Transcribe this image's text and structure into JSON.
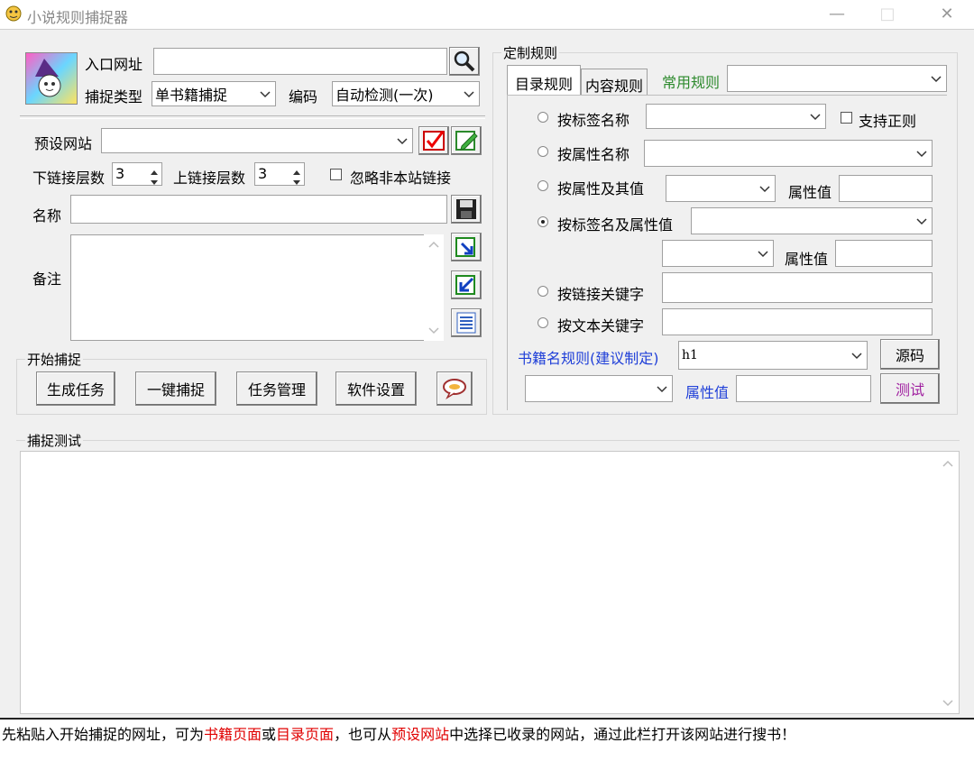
{
  "window": {
    "title": "小说规则捕捉器",
    "minimize": "—",
    "maximize": "□",
    "close": "✕"
  },
  "top": {
    "entry_url_label": "入口网址",
    "entry_url_value": "",
    "capture_type_label": "捕捉类型",
    "capture_type_value": "单书籍捕捉",
    "encoding_label": "编码",
    "encoding_value": "自动检测(一次)"
  },
  "preset": {
    "preset_site_label": "预设网站",
    "preset_site_value": "",
    "down_depth_label": "下链接层数",
    "down_depth_value": "3",
    "up_depth_label": "上链接层数",
    "up_depth_value": "3",
    "ignore_offsite_label": "忽略非本站链接",
    "ignore_offsite_checked": false,
    "name_label": "名称",
    "name_value": "",
    "note_label": "备注",
    "note_value": ""
  },
  "start_group": {
    "label": "开始捕捉",
    "buttons": [
      "生成任务",
      "一键捕捉",
      "任务管理",
      "软件设置"
    ]
  },
  "rules": {
    "group_label": "定制规则",
    "tabs": [
      "目录规则",
      "内容规则"
    ],
    "active_tab": 0,
    "common_rules_label": "常用规则",
    "common_rules_value": "",
    "by_tag_name": "按标签名称",
    "support_regex": "支持正则",
    "support_regex_checked": false,
    "by_attr_name": "按属性名称",
    "by_attr_value": "按属性及其值",
    "attr_value_label": "属性值",
    "by_tag_and_attr": "按标签名及属性值",
    "attr_value_label2": "属性值",
    "by_link_keyword": "按链接关键字",
    "by_text_keyword": "按文本关键字",
    "selected_option": "by_tag_and_attr",
    "book_name_rule_label": "书籍名规则(建议制定)",
    "book_name_rule_value": "h1",
    "source_button": "源码",
    "attr_value_label3": "属性值",
    "test_button": "测试"
  },
  "test_group": {
    "label": "捕捉测试",
    "content": ""
  },
  "statusbar": {
    "parts": [
      {
        "text": "先粘贴入开始捕捉的网址，可为",
        "color": "#000000"
      },
      {
        "text": "书籍页面",
        "color": "#e00000"
      },
      {
        "text": "或",
        "color": "#000000"
      },
      {
        "text": "目录页面",
        "color": "#e00000"
      },
      {
        "text": "，也可从",
        "color": "#000000"
      },
      {
        "text": "预设网站",
        "color": "#e00000"
      },
      {
        "text": "中选择已收录的网站，通过此栏打开该网站进行搜书！",
        "color": "#000000"
      }
    ]
  },
  "icons": [
    "app-icon",
    "wizard-logo-icon",
    "search-icon",
    "check-icon",
    "edit-icon",
    "save-icon",
    "import-icon",
    "export-icon",
    "list-icon",
    "chat-icon"
  ]
}
